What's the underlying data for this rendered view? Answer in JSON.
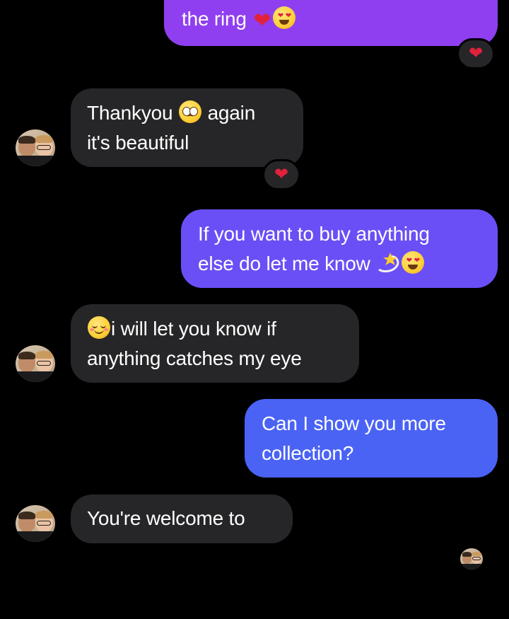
{
  "messages": [
    {
      "id": "m1",
      "direction": "outgoing",
      "lines": [
        "the ring"
      ],
      "trailing_emojis": [
        "red-heart",
        "heart-eyes-face"
      ],
      "reaction": "red-heart"
    },
    {
      "id": "m2",
      "direction": "incoming",
      "lines": [
        "Thankyou",
        "again",
        "it's beautiful"
      ],
      "inline_emojis": [
        "pleading-face"
      ],
      "reaction": "red-heart"
    },
    {
      "id": "m3",
      "direction": "outgoing",
      "lines": [
        "If you want to buy anything",
        "else do let me know"
      ],
      "trailing_emojis": [
        "dizzy-star",
        "heart-eyes-face"
      ]
    },
    {
      "id": "m4",
      "direction": "incoming",
      "leading_emoji": "smiling-face",
      "lines": [
        "i will let you know if",
        "anything catches my eye"
      ]
    },
    {
      "id": "m5",
      "direction": "outgoing",
      "lines": [
        "Can I show you more",
        "collection?"
      ]
    },
    {
      "id": "m6",
      "direction": "incoming",
      "lines": [
        "You're welcome to"
      ]
    }
  ],
  "colors": {
    "background": "#000000",
    "outgoing_top": "#8f3ff0",
    "outgoing_mid": "#6a4ff6",
    "outgoing_bottom": "#4a63f5",
    "incoming": "#262628",
    "heart": "#e0223b"
  },
  "icons": {
    "reaction": "red-heart-icon",
    "avatar": "contact-avatar-icon",
    "seen": "seen-avatar-icon"
  }
}
